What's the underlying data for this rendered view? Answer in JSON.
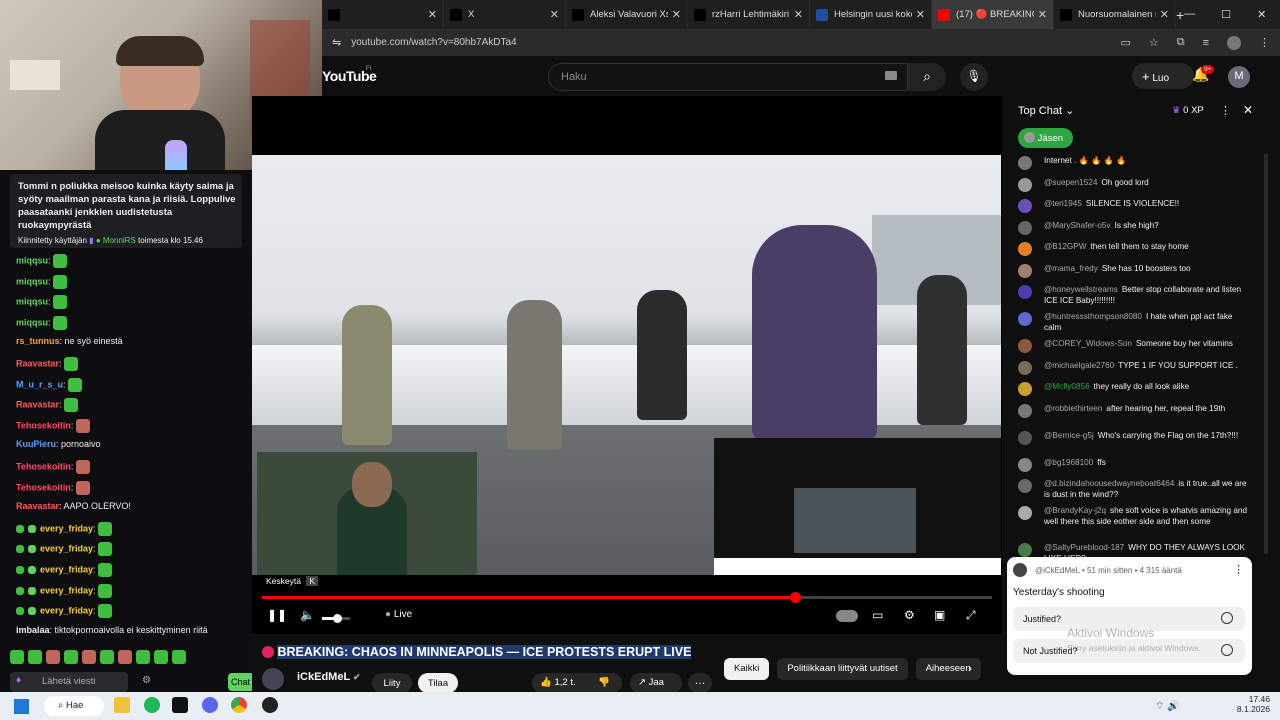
{
  "browser": {
    "tabs": [
      {
        "title": "",
        "icon": "x-icon"
      },
      {
        "title": "X",
        "icon": "x-icon"
      },
      {
        "title": "Aleksi Valavuori Xssa",
        "icon": "x-icon"
      },
      {
        "title": "rzHarri Lehtimäkiri X",
        "icon": "x-icon"
      },
      {
        "title": "Helsingin uusi kokeilu",
        "icon": "news-icon"
      },
      {
        "title": "(17) 🔴 BREAKING: C",
        "icon": "youtube-icon",
        "active": true
      },
      {
        "title": "Nuorsuomalainen nu",
        "icon": "x-icon"
      }
    ],
    "new_tab": "+",
    "url": "youtube.com/watch?v=80hb7AkDTa4"
  },
  "youtube": {
    "logo": "YouTube",
    "region": "FI",
    "search_placeholder": "Haku",
    "create_label": "Luo",
    "notif_count": "9+",
    "avatar_letter": "M"
  },
  "twitch": {
    "pinned_text": "Tommi n poliukka meisoo kuinka käyty saima ja syöty maailman parasta kana ja riisiä. Loppulive paasataanki jenkkien uudistetusta ruokaympyrästä",
    "pinned_by": "Kiinnitetty käyttäjän",
    "pinned_user": "MonniRS",
    "pinned_time": "toimesta klo 15.46",
    "messages": [
      {
        "user": "miqqsu",
        "color": "#5fd35f",
        "text": "",
        "emote": "green"
      },
      {
        "user": "miqqsu",
        "color": "#5fd35f",
        "text": "",
        "emote": "green"
      },
      {
        "user": "miqqsu",
        "color": "#5fd35f",
        "text": "",
        "emote": "green"
      },
      {
        "user": "miqqsu",
        "color": "#5fd35f",
        "text": "",
        "emote": "green"
      },
      {
        "user": "rs_tunnus",
        "color": "#ff9a3c",
        "text": "ne syö einestä",
        "emote": ""
      },
      {
        "user": "Raavastar",
        "color": "#ff5a5a",
        "text": "",
        "emote": "green"
      },
      {
        "user": "M_u_r_s_u",
        "color": "#4fa3ff",
        "text": "",
        "emote": "green"
      },
      {
        "user": "Raavastar",
        "color": "#ff5a5a",
        "text": "",
        "emote": "green"
      },
      {
        "user": "Tehosekoitin",
        "color": "#ff4a6a",
        "text": "",
        "emote": "red"
      },
      {
        "user": "KuuPieru",
        "color": "#4fa3ff",
        "text": "pornoaivo",
        "emote": ""
      },
      {
        "user": "Tehosekoitin",
        "color": "#ff4a6a",
        "text": "",
        "emote": "red"
      },
      {
        "user": "Tehosekoitin",
        "color": "#ff4a6a",
        "text": "",
        "emote": "red"
      },
      {
        "user": "Raavastar",
        "color": "#ff5a5a",
        "text": "AAPO OLERVO!",
        "emote": ""
      },
      {
        "user": "every_friday",
        "color": "#f4d03f",
        "text": "",
        "emote": "green"
      },
      {
        "user": "every_friday",
        "color": "#f4d03f",
        "text": "",
        "emote": "green"
      },
      {
        "user": "every_friday",
        "color": "#f4d03f",
        "text": "",
        "emote": "green"
      },
      {
        "user": "every_friday",
        "color": "#f4d03f",
        "text": "",
        "emote": "green"
      },
      {
        "user": "every_friday",
        "color": "#f4d03f",
        "text": "",
        "emote": "green"
      },
      {
        "user": "imbalaa",
        "color": "#efeff1",
        "text": "tiktokpornoaivolla ei keskittyminen riitä",
        "emote": ""
      }
    ],
    "input_placeholder": "Lähetä viesti",
    "chat_button": "Chat"
  },
  "player": {
    "tooltip": "Keskeytä",
    "tooltip_key": "K",
    "live_label": "Live",
    "progress": 0.73,
    "volume": 0.55
  },
  "video": {
    "title": "BREAKING: CHAOS IN MINNEAPOLIS — ICE PROTESTS ERUPT LIVE",
    "channel": "iCkEdMeL",
    "join_label": "Liity",
    "subscribe_label": "Tilaa",
    "likes": "1,2 t.",
    "share_label": "Jaa",
    "chips": [
      "Kaikki",
      "Politiikkaan liittyvät uutiset",
      "Aiheeseen"
    ]
  },
  "ytchat": {
    "header": "Top Chat",
    "xp": "0 XP",
    "member_button": "Jäsen",
    "messages": [
      {
        "user": "",
        "text": "Internet . 🔥 🔥 🔥 🔥",
        "av": "#777"
      },
      {
        "user": "@suepen1524",
        "text": "Oh good lord",
        "av": "#999"
      },
      {
        "user": "@teri1945",
        "text": "SILENCE IS VIOLENCE!!",
        "av": "#6a4fb6"
      },
      {
        "user": "@MaryShafer-o5v",
        "text": "Is she high?",
        "av": "#666"
      },
      {
        "user": "@B12GPW",
        "text": "then tell them to stay home",
        "av": "#e67e22"
      },
      {
        "user": "@mama_fredy",
        "text": "She has 10 boosters too",
        "av": "#a08070"
      },
      {
        "user": "@honeywellstreams",
        "text": "Better stop collaborate and listen ICE ICE Baby!!!!!!!!!",
        "av": "#4a3fb0"
      },
      {
        "user": "@huntresssthompson8080",
        "text": "I hate when ppl act fake calm",
        "av": "#5b6bcf"
      },
      {
        "user": "@COREY_Widows-Son",
        "text": "Someone buy her vitamins",
        "av": "#8b5a3c"
      },
      {
        "user": "@michaelgale2760",
        "text": "TYPE 1 IF YOU SUPPORT ICE .",
        "av": "#7a6a5a"
      },
      {
        "user": "@Mcfly0856",
        "text": "they really do all look alike",
        "av": "#c9a030",
        "green": true
      },
      {
        "user": "@robblethirteen",
        "text": "after hearing her, repeal the 19th",
        "av": "#777"
      },
      {
        "user": "@Bernice-g5j",
        "text": "Who's carrying the Flag on the 17th?!!!",
        "av": "#555"
      },
      {
        "user": "@bg1968100",
        "text": "ffs",
        "av": "#888"
      },
      {
        "user": "@d.bizindahoousedwayneboat6464",
        "text": "is it true..all we are is dust in the wind??",
        "av": "#6a6a6a"
      },
      {
        "user": "@BrandyKay-j2q",
        "text": "she soft voice is whatvis amazing and well there this side eother side and then some",
        "av": "#aaa"
      },
      {
        "user": "@SaltyPureblood-187",
        "text": "WHY DO THEY ALWAYS LOOK LIKE HER?",
        "av": "#4a7a4a"
      }
    ],
    "poll": {
      "author": "@iCkEdMeL",
      "meta": "• 51 min sitten • 4 315 ääntä",
      "question": "Yesterday's shooting",
      "options": [
        "Justified?",
        "Not Justified?"
      ]
    },
    "watermark_title": "Aktivoi Windows",
    "watermark_sub": "Siirry asetuksiin ja aktivoi Windows."
  },
  "taskbar": {
    "search": "Hae",
    "time": "17.46",
    "date": "8.1.2026"
  }
}
